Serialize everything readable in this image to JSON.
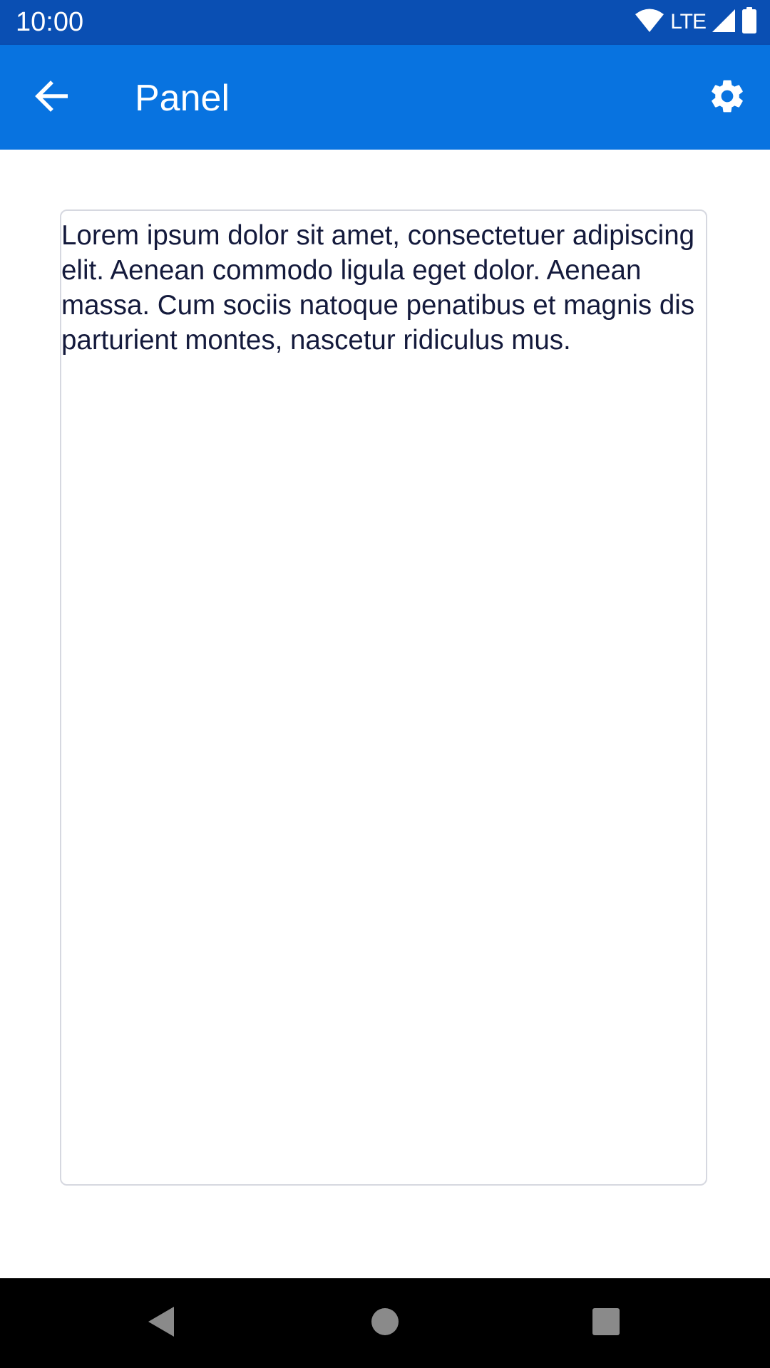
{
  "status_bar": {
    "time": "10:00",
    "network_label": "LTE",
    "icons": [
      "wifi-icon",
      "cell-signal-icon",
      "battery-icon"
    ]
  },
  "app_bar": {
    "title": "Panel",
    "back_icon": "arrow-back-icon",
    "settings_icon": "gear-icon",
    "background_color": "#0873e0"
  },
  "panel": {
    "text": "Lorem ipsum dolor sit amet, consectetuer adipiscing elit. Aenean commodo ligula eget dolor. Aenean massa. Cum sociis natoque penatibus et magnis dis parturient montes, nascetur ridiculus mus."
  },
  "nav_bar": {
    "buttons": [
      "back-triangle-icon",
      "home-circle-icon",
      "recents-square-icon"
    ]
  },
  "colors": {
    "status_bar": "#0a4fb3",
    "app_bar": "#0873e0",
    "text": "#141a3c",
    "panel_border": "#d6d8e0"
  }
}
